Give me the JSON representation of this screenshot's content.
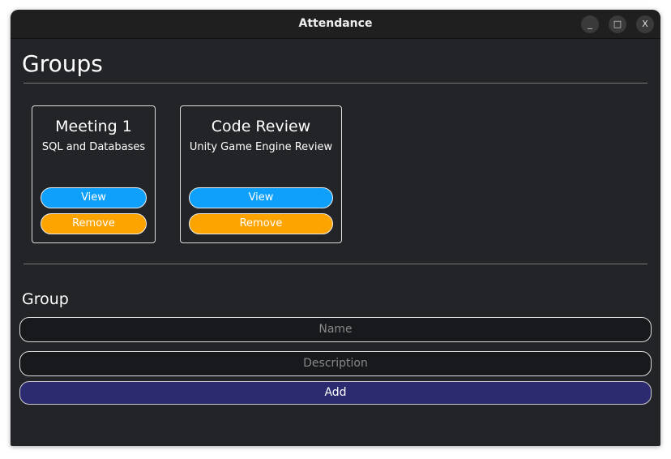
{
  "window": {
    "title": "Attendance",
    "minimize": "_",
    "maximize": "□",
    "close": "X"
  },
  "page": {
    "heading": "Groups"
  },
  "groups": [
    {
      "name": "Meeting 1",
      "description": "SQL and Databases",
      "view_label": "View",
      "remove_label": "Remove"
    },
    {
      "name": "Code Review",
      "description": "Unity Game Engine Review",
      "view_label": "View",
      "remove_label": "Remove"
    }
  ],
  "form": {
    "heading": "Group",
    "name_placeholder": "Name",
    "description_placeholder": "Description",
    "add_label": "Add"
  },
  "colors": {
    "view": "#0fa0fb",
    "remove": "#fea400",
    "add": "#2c2b70"
  }
}
